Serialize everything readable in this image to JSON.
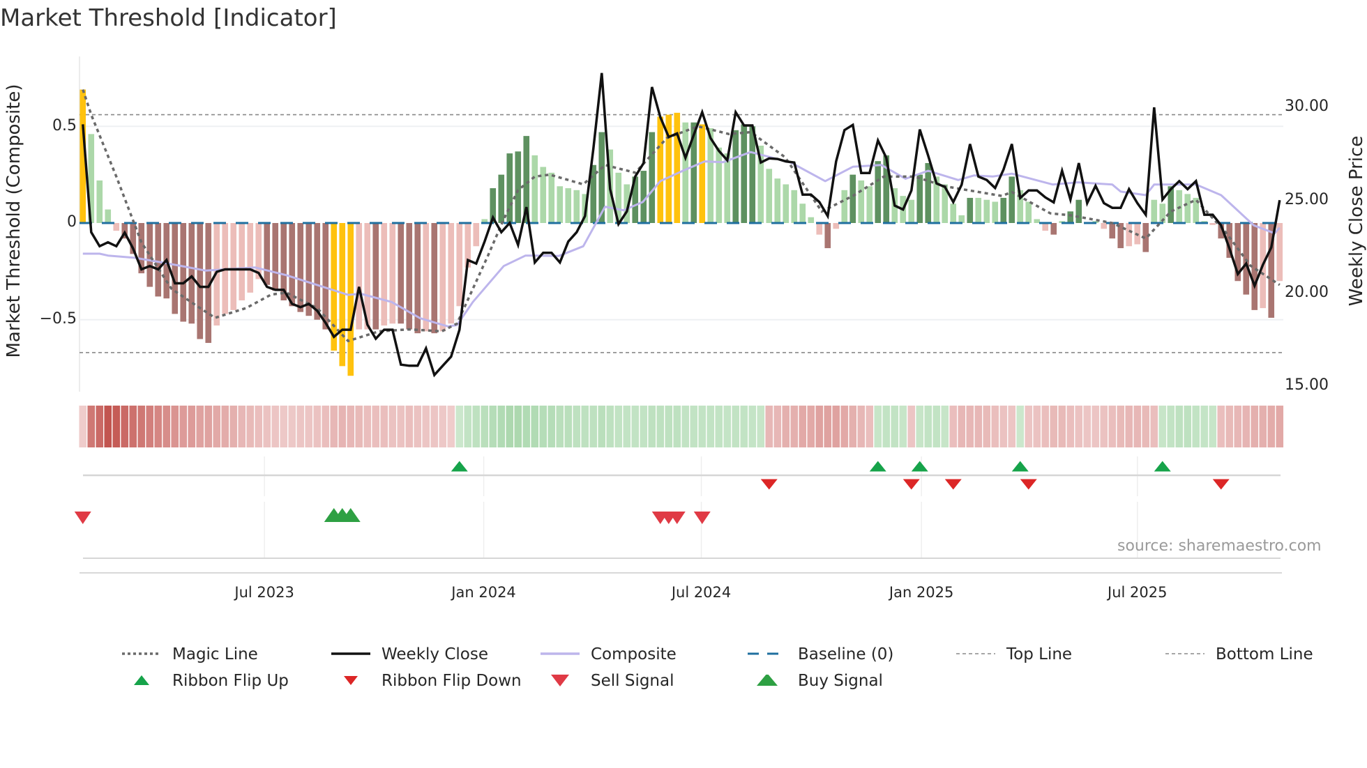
{
  "title": "Market Threshold [Indicator]",
  "chart_data": {
    "type": "bar+line",
    "title": "Market Threshold [Indicator]",
    "ylabel_left": "Market Threshold (Composite)",
    "ylabel_right": "Weekly Close Price",
    "ylim_left": [
      -0.87,
      0.86
    ],
    "ylim_right": [
      14.7,
      32.7
    ],
    "left_ticks": [
      {
        "value": 0.5,
        "label": "0.5"
      },
      {
        "value": 0,
        "label": "0"
      },
      {
        "value": -0.5,
        "label": "−0.5"
      }
    ],
    "right_ticks": [
      {
        "value": 30,
        "label": "30.00"
      },
      {
        "value": 25,
        "label": "25.00"
      },
      {
        "value": 20,
        "label": "20.00"
      },
      {
        "value": 15,
        "label": "15.00"
      }
    ],
    "x_ticks": [
      {
        "label": "Jul 2023",
        "index": 21.7
      },
      {
        "label": "Jan 2024",
        "index": 47.9
      },
      {
        "label": "Jul 2024",
        "index": 73.9
      },
      {
        "label": "Jan 2025",
        "index": 100.2
      },
      {
        "label": "Jul 2025",
        "index": 126
      }
    ],
    "top_line": 0.56,
    "bottom_line": -0.67,
    "baseline": 0,
    "bar_state_legend": {
      "Y": "extreme",
      "G": "strong up",
      "g": "up",
      "R": "strong down",
      "r": "down"
    },
    "composite_bars": [
      0.69,
      0.46,
      0.22,
      0.07,
      -0.04,
      -0.08,
      -0.16,
      -0.26,
      -0.33,
      -0.38,
      -0.39,
      -0.47,
      -0.51,
      -0.52,
      -0.6,
      -0.62,
      -0.53,
      -0.47,
      -0.45,
      -0.4,
      -0.36,
      -0.29,
      -0.32,
      -0.35,
      -0.4,
      -0.43,
      -0.46,
      -0.48,
      -0.5,
      -0.55,
      -0.66,
      -0.74,
      -0.79,
      -0.55,
      -0.55,
      -0.55,
      -0.53,
      -0.52,
      -0.52,
      -0.55,
      -0.57,
      -0.56,
      -0.57,
      -0.56,
      -0.52,
      -0.43,
      -0.23,
      -0.12,
      0.02,
      0.18,
      0.25,
      0.36,
      0.37,
      0.45,
      0.35,
      0.29,
      0.26,
      0.19,
      0.18,
      0.17,
      0.15,
      0.3,
      0.47,
      0.38,
      0.26,
      0.2,
      0.24,
      0.27,
      0.47,
      0.55,
      0.56,
      0.57,
      0.52,
      0.52,
      0.51,
      0.49,
      0.39,
      0.36,
      0.48,
      0.51,
      0.5,
      0.4,
      0.28,
      0.23,
      0.2,
      0.17,
      0.1,
      0.03,
      -0.06,
      -0.13,
      -0.03,
      0.17,
      0.25,
      0.22,
      0.19,
      0.32,
      0.35,
      0.18,
      0.14,
      0.12,
      0.25,
      0.31,
      0.24,
      0.2,
      0.1,
      0.04,
      0.13,
      0.13,
      0.12,
      0.11,
      0.13,
      0.24,
      0.17,
      0.11,
      0.02,
      -0.04,
      -0.06,
      0.01,
      0.06,
      0.12,
      0.0,
      0.01,
      -0.03,
      -0.08,
      -0.13,
      -0.12,
      -0.11,
      -0.15,
      0.12,
      0.1,
      0.19,
      0.17,
      0.15,
      0.13,
      0.01,
      -0.01,
      -0.08,
      -0.18,
      -0.3,
      -0.37,
      -0.45,
      -0.44,
      -0.49,
      -0.3
    ],
    "bar_states": "YgggrRRRRRRRRRRRrrrrrrRRRRRRRRYYYrrRrrRRRrRrrrrrgGGGGGgggggggGGgggGGGYYYgGYgggGGGgggggggrRrgGggGGgggGGggggGgggGGgggrRgGGggrRRrrRggGggggrRRRRRrRr",
    "weekly_close": [
      29.08,
      23.29,
      22.54,
      22.75,
      22.54,
      23.27,
      22.42,
      21.3,
      21.48,
      21.3,
      21.8,
      20.55,
      20.55,
      20.92,
      20.36,
      20.36,
      21.17,
      21.3,
      21.3,
      21.3,
      21.3,
      21.11,
      20.36,
      20.2,
      20.2,
      19.45,
      19.27,
      19.45,
      19.08,
      18.43,
      17.68,
      18.06,
      18.06,
      20.36,
      18.33,
      17.58,
      18.06,
      18.06,
      16.19,
      16.13,
      16.13,
      17.06,
      15.63,
      16.13,
      16.62,
      18.06,
      21.8,
      21.61,
      22.79,
      24.08,
      23.29,
      23.79,
      22.61,
      24.64,
      21.67,
      22.19,
      22.19,
      21.67,
      22.79,
      23.29,
      24.16,
      27.78,
      31.83,
      25.6,
      23.73,
      24.41,
      26.28,
      27.0,
      31.08,
      29.46,
      28.4,
      28.59,
      27.28,
      28.52,
      29.73,
      28.34,
      27.65,
      27.15,
      29.73,
      29.02,
      29.02,
      27.03,
      27.25,
      27.22,
      27.09,
      27.03,
      25.31,
      25.31,
      24.91,
      24.16,
      27.09,
      28.77,
      29.05,
      26.47,
      26.47,
      28.21,
      27.28,
      24.72,
      24.51,
      25.53,
      28.8,
      27.4,
      25.91,
      25.72,
      24.91,
      25.84,
      28.02,
      26.28,
      26.09,
      25.66,
      26.65,
      28.02,
      25.13,
      25.53,
      25.53,
      25.16,
      24.89,
      26.59,
      25.04,
      27.0,
      24.85,
      25.78,
      24.85,
      24.6,
      24.6,
      25.6,
      24.85,
      24.23,
      29.99,
      25.04,
      25.6,
      26.03,
      25.6,
      26.03,
      24.23,
      24.23,
      23.66,
      22.42,
      21.05,
      21.61,
      20.42,
      21.55,
      22.48,
      25.01
    ],
    "magic_line": [
      [
        0,
        0.69
      ],
      [
        1,
        0.56
      ],
      [
        4,
        0.24
      ],
      [
        7,
        -0.1
      ],
      [
        10.6,
        -0.34
      ],
      [
        14,
        -0.44
      ],
      [
        15.8,
        -0.49
      ],
      [
        19.5,
        -0.44
      ],
      [
        22.5,
        -0.37
      ],
      [
        24.3,
        -0.36
      ],
      [
        28,
        -0.44
      ],
      [
        31.7,
        -0.61
      ],
      [
        35.4,
        -0.56
      ],
      [
        39,
        -0.55
      ],
      [
        42.9,
        -0.56
      ],
      [
        44.7,
        -0.52
      ],
      [
        46.6,
        -0.34
      ],
      [
        48.4,
        -0.17
      ],
      [
        50.3,
        0.02
      ],
      [
        52,
        0.17
      ],
      [
        54,
        0.24
      ],
      [
        55.8,
        0.25
      ],
      [
        59.8,
        0.2
      ],
      [
        62.4,
        0.3
      ],
      [
        66,
        0.26
      ],
      [
        69.8,
        0.44
      ],
      [
        73.5,
        0.5
      ],
      [
        77.2,
        0.46
      ],
      [
        79.8,
        0.47
      ],
      [
        83.9,
        0.34
      ],
      [
        88.3,
        0.06
      ],
      [
        92,
        0.14
      ],
      [
        95.7,
        0.24
      ],
      [
        99.4,
        0.24
      ],
      [
        103,
        0.19
      ],
      [
        109.8,
        0.14
      ],
      [
        111,
        0.16
      ],
      [
        115.6,
        0.05
      ],
      [
        118,
        0.04
      ],
      [
        123,
        0.0
      ],
      [
        127,
        -0.08
      ],
      [
        130,
        0.06
      ],
      [
        133,
        0.12
      ],
      [
        136.6,
        -0.05
      ],
      [
        139.5,
        -0.22
      ],
      [
        143,
        -0.32
      ]
    ],
    "composite_line": [
      [
        0,
        22.14
      ],
      [
        2,
        22.14
      ],
      [
        3,
        22.04
      ],
      [
        6.2,
        21.92
      ],
      [
        9.5,
        21.67
      ],
      [
        14.7,
        21.23
      ],
      [
        20.6,
        21.4
      ],
      [
        24.3,
        20.99
      ],
      [
        31.7,
        19.93
      ],
      [
        33.2,
        19.99
      ],
      [
        36.9,
        19.55
      ],
      [
        40.3,
        18.68
      ],
      [
        43.6,
        18.24
      ],
      [
        44.7,
        18.31
      ],
      [
        46.6,
        19.55
      ],
      [
        50.3,
        21.48
      ],
      [
        52.9,
        22.04
      ],
      [
        56.9,
        22.02
      ],
      [
        59.8,
        22.54
      ],
      [
        62.4,
        24.66
      ],
      [
        64.6,
        24.47
      ],
      [
        66.9,
        24.91
      ],
      [
        69,
        26.03
      ],
      [
        71.7,
        26.59
      ],
      [
        74.3,
        27.09
      ],
      [
        76.5,
        27.05
      ],
      [
        79.8,
        27.59
      ],
      [
        84.6,
        27.03
      ],
      [
        88.7,
        26.03
      ],
      [
        92,
        26.8
      ],
      [
        95.4,
        26.9
      ],
      [
        98.3,
        26.16
      ],
      [
        101,
        26.59
      ],
      [
        104.6,
        26.09
      ],
      [
        106.5,
        26.34
      ],
      [
        108.7,
        26.28
      ],
      [
        111,
        26.43
      ],
      [
        115.9,
        25.85
      ],
      [
        118.9,
        25.97
      ],
      [
        123,
        25.85
      ],
      [
        124,
        25.47
      ],
      [
        127,
        25.28
      ],
      [
        128,
        25.85
      ],
      [
        133,
        25.85
      ],
      [
        136,
        25.28
      ],
      [
        139.9,
        23.66
      ],
      [
        142.4,
        23.23
      ],
      [
        143,
        23.54
      ]
    ],
    "ribbon": [
      -0.15,
      -0.75,
      -0.85,
      -1.0,
      -0.95,
      -0.85,
      -0.8,
      -0.75,
      -0.7,
      -0.65,
      -0.6,
      -0.55,
      -0.5,
      -0.5,
      -0.45,
      -0.45,
      -0.4,
      -0.38,
      -0.35,
      -0.3,
      -0.28,
      -0.25,
      -0.22,
      -0.2,
      -0.18,
      -0.18,
      -0.2,
      -0.2,
      -0.22,
      -0.25,
      -0.3,
      -0.32,
      -0.3,
      -0.28,
      -0.25,
      -0.25,
      -0.25,
      -0.22,
      -0.22,
      -0.25,
      -0.22,
      -0.2,
      -0.2,
      -0.18,
      -0.15,
      0.2,
      0.3,
      0.35,
      0.4,
      0.45,
      0.5,
      0.55,
      0.55,
      0.5,
      0.5,
      0.45,
      0.45,
      0.4,
      0.4,
      0.35,
      0.35,
      0.35,
      0.4,
      0.35,
      0.3,
      0.3,
      0.3,
      0.3,
      0.35,
      0.35,
      0.35,
      0.35,
      0.3,
      0.3,
      0.3,
      0.3,
      0.3,
      0.28,
      0.3,
      0.3,
      0.28,
      0.25,
      -0.3,
      -0.3,
      -0.35,
      -0.35,
      -0.4,
      -0.4,
      -0.45,
      -0.45,
      -0.45,
      -0.4,
      -0.35,
      -0.3,
      -0.25,
      0.25,
      0.3,
      0.3,
      0.25,
      -0.2,
      0.25,
      0.3,
      0.3,
      0.25,
      -0.25,
      -0.3,
      -0.3,
      -0.3,
      -0.28,
      -0.25,
      -0.22,
      -0.2,
      0.2,
      -0.2,
      -0.22,
      -0.25,
      -0.28,
      -0.28,
      -0.25,
      -0.22,
      -0.2,
      -0.2,
      -0.22,
      -0.25,
      -0.28,
      -0.3,
      -0.3,
      -0.28,
      -0.25,
      0.25,
      0.3,
      0.35,
      0.35,
      0.3,
      0.28,
      0.25,
      -0.25,
      -0.28,
      -0.3,
      -0.32,
      -0.35,
      -0.35,
      -0.38,
      -0.4
    ],
    "ribbon_flip_up": [
      45,
      95,
      100,
      112,
      129
    ],
    "ribbon_flip_down": [
      82,
      99,
      104,
      113,
      136
    ],
    "sell_signal": [
      0,
      69,
      70,
      71,
      74
    ],
    "buy_signal": [
      30,
      31,
      32
    ]
  },
  "legend": [
    {
      "label": "Magic Line",
      "symbol": "dotted-line"
    },
    {
      "label": "Weekly Close",
      "symbol": "solid-line"
    },
    {
      "label": "Composite",
      "symbol": "lavender-line"
    },
    {
      "label": "Baseline (0)",
      "symbol": "dashed-line"
    },
    {
      "label": "Top Line",
      "symbol": "thin-dashed-line"
    },
    {
      "label": "Bottom Line",
      "symbol": "thin-dashed-line"
    },
    {
      "label": "Ribbon Flip Up",
      "symbol": "small-up-triangle"
    },
    {
      "label": "Ribbon Flip Down",
      "symbol": "small-down-triangle"
    },
    {
      "label": "Sell Signal",
      "symbol": "down-triangle"
    },
    {
      "label": "Buy Signal",
      "symbol": "up-triangle"
    }
  ],
  "source": "source: sharemaestro.com",
  "colors": {
    "extreme": "#FFC20E",
    "strong_up": "#5e9160",
    "up": "#acd8a9",
    "strong_down": "#a97571",
    "down": "#ecbdb9",
    "price": "#111111",
    "composite": "#bdb5ec",
    "magic": "#6a6a6a",
    "baseline": "#1f6f9f",
    "threshold": "#888888",
    "flip_up": "#16a34a",
    "flip_down": "#dc2626",
    "sell": "#e03a45",
    "buy": "#2ea043"
  }
}
